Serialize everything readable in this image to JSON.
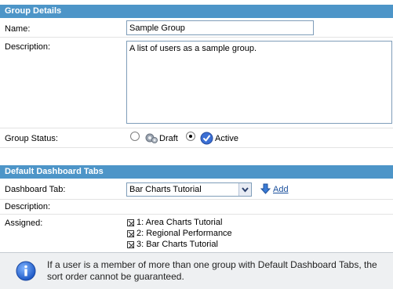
{
  "group_details": {
    "header": "Group Details",
    "name_label": "Name:",
    "name_value": "Sample Group",
    "description_label": "Description:",
    "description_value": "A list of users as a sample group.",
    "status_label": "Group Status:",
    "status_options": [
      {
        "label": "Draft",
        "selected": false,
        "icon": "gears-icon"
      },
      {
        "label": "Active",
        "selected": true,
        "icon": "check-badge-icon"
      }
    ]
  },
  "dashboard_tabs": {
    "header": "Default Dashboard Tabs",
    "tab_label": "Dashboard Tab:",
    "tab_selected": "Bar Charts Tutorial",
    "add_label": "Add",
    "description_label": "Description:",
    "assigned_label": "Assigned:",
    "assigned_items": [
      "1: Area Charts Tutorial",
      "2: Regional Performance",
      "3: Bar Charts Tutorial"
    ]
  },
  "info": {
    "icon": "info-icon",
    "message": "If a user is a member of more than one group with Default Dashboard Tabs, the sort order cannot be guaranteed."
  },
  "colors": {
    "header_bg": "#4d95c8",
    "link": "#1a4f9c",
    "info_bg": "#eef0f2"
  }
}
